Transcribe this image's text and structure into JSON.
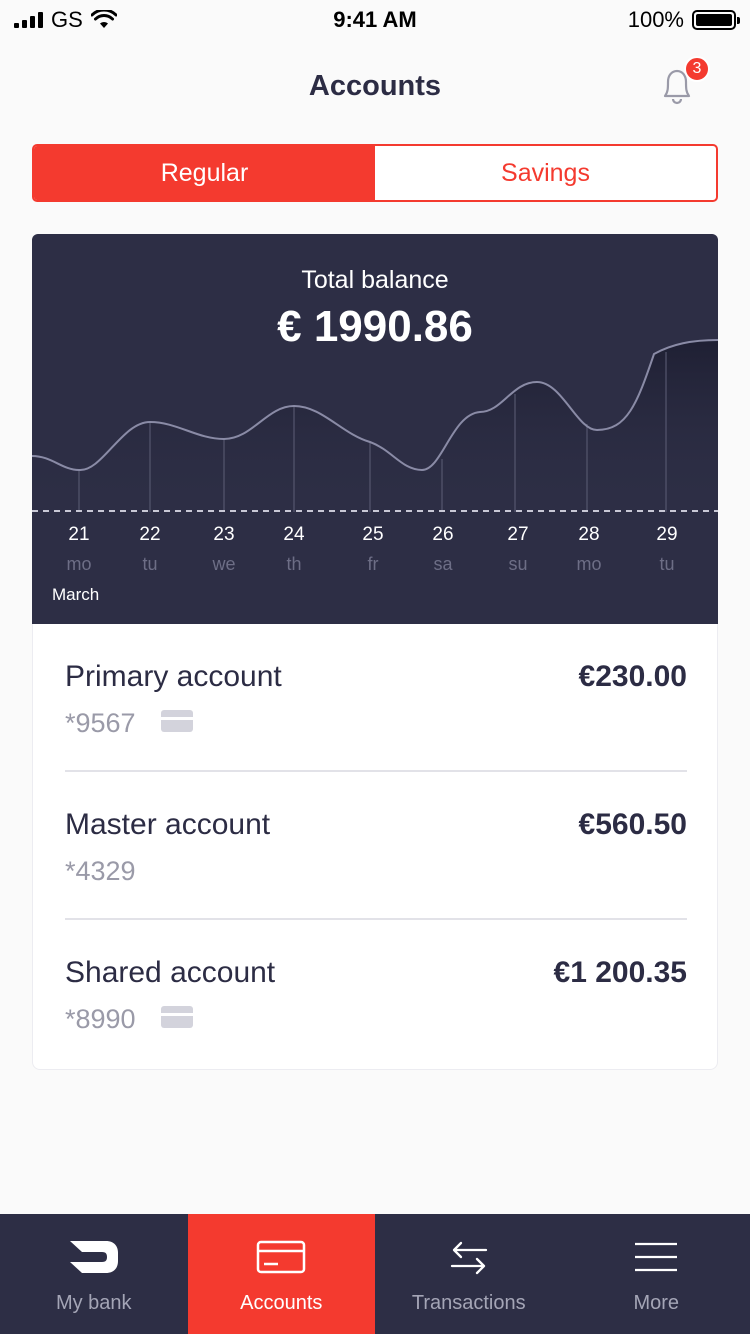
{
  "status_bar": {
    "carrier": "GS",
    "time": "9:41 AM",
    "battery": "100%"
  },
  "header": {
    "title": "Accounts",
    "notification_count": "3",
    "icon": "bell-icon"
  },
  "segment": {
    "options": [
      "Regular",
      "Savings"
    ],
    "selected": "Regular"
  },
  "balance": {
    "label": "Total balance",
    "value": "€ 1990.86",
    "month": "March",
    "days": [
      {
        "num": "21",
        "name": "mo"
      },
      {
        "num": "22",
        "name": "tu"
      },
      {
        "num": "23",
        "name": "we"
      },
      {
        "num": "24",
        "name": "th"
      },
      {
        "num": "25",
        "name": "fr"
      },
      {
        "num": "26",
        "name": "sa"
      },
      {
        "num": "27",
        "name": "su"
      },
      {
        "num": "28",
        "name": "mo"
      },
      {
        "num": "29",
        "name": "tu"
      }
    ]
  },
  "accounts": [
    {
      "name": "Primary account",
      "number": "*9567",
      "amount": "€230.00",
      "has_card": true
    },
    {
      "name": "Master account",
      "number": "*4329",
      "amount": "€560.50",
      "has_card": false
    },
    {
      "name": "Shared account",
      "number": "*8990",
      "amount": "€1 200.35",
      "has_card": true
    }
  ],
  "tab_bar": {
    "tabs": [
      {
        "label": "My bank",
        "icon": "bank-logo-icon"
      },
      {
        "label": "Accounts",
        "icon": "card-icon"
      },
      {
        "label": "Transactions",
        "icon": "transfer-arrows-icon"
      },
      {
        "label": "More",
        "icon": "menu-icon"
      }
    ],
    "active": "Accounts"
  },
  "colors": {
    "accent": "#f43a2f",
    "dark": "#2d2e45",
    "text": "#2c2c44",
    "muted": "#9a9aa8"
  }
}
